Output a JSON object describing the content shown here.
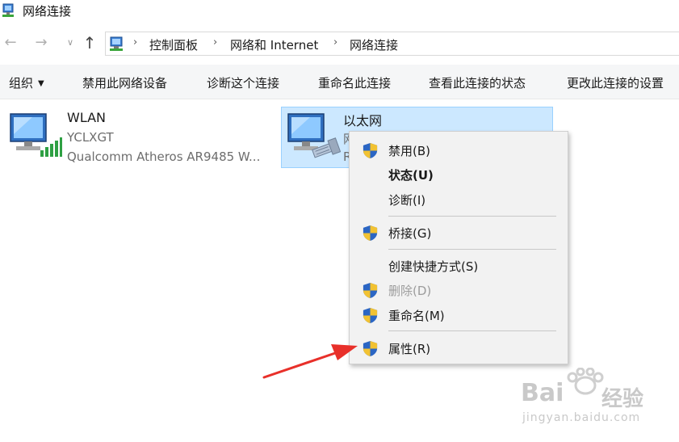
{
  "window": {
    "title": "网络连接",
    "icon": "network-connections-icon"
  },
  "nav": {
    "back_icon": "back-arrow-icon",
    "forward_icon": "forward-arrow-icon",
    "recent_icon": "chevron-down-icon",
    "up_icon": "up-arrow-icon"
  },
  "breadcrumbs": [
    "控制面板",
    "网络和 Internet",
    "网络连接"
  ],
  "toolbar": {
    "organize": "组织",
    "disable": "禁用此网络设备",
    "diagnose": "诊断这个连接",
    "rename": "重命名此连接",
    "view_status": "查看此连接的状态",
    "change_settings": "更改此连接的设置"
  },
  "adapters": [
    {
      "name": "WLAN",
      "line1": "YCLXGT",
      "line2": "Qualcomm Atheros AR9485 W...",
      "icon": "wifi-adapter-icon"
    },
    {
      "name": "以太网",
      "line1": "网",
      "line2": "R",
      "icon": "ethernet-adapter-icon"
    }
  ],
  "context_menu": {
    "items": [
      {
        "label": "禁用(B)",
        "shield": true
      },
      {
        "label": "状态(U)",
        "shield": false,
        "bold": true
      },
      {
        "label": "诊断(I)",
        "shield": false
      },
      {
        "label": "桥接(G)",
        "shield": true
      },
      {
        "label": "创建快捷方式(S)",
        "shield": false
      },
      {
        "label": "删除(D)",
        "shield": true,
        "disabled": true
      },
      {
        "label": "重命名(M)",
        "shield": true
      },
      {
        "label": "属性(R)",
        "shield": true
      }
    ]
  },
  "watermark": {
    "brand": "Bai",
    "brand2": "经验",
    "url": "jingyan.baidu.com"
  },
  "colors": {
    "selection": "#cce8ff",
    "arrow": "#e8302a",
    "menu_bg": "#f2f2f2"
  }
}
